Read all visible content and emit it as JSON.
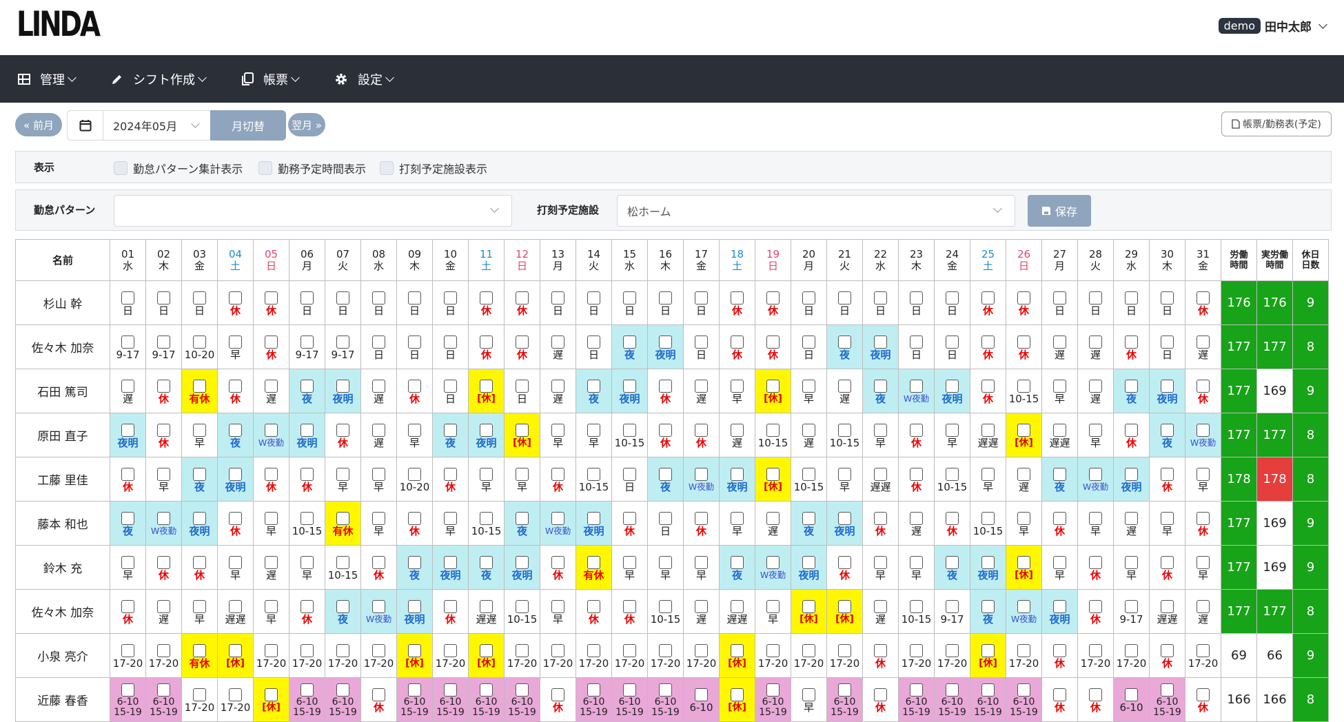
{
  "app": {
    "logo": "LINDA"
  },
  "user": {
    "badge": "demo",
    "name": "田中太郎"
  },
  "nav": [
    {
      "label": "管理",
      "icon": "grid-icon"
    },
    {
      "label": "シフト作成",
      "icon": "pencil-icon"
    },
    {
      "label": "帳票",
      "icon": "copy-icon"
    },
    {
      "label": "設定",
      "icon": "gear-icon"
    }
  ],
  "toolbar": {
    "prev": "« 前月",
    "month": "2024年05月",
    "switch": "月切替",
    "next": "翌月 »",
    "report": "帳票/勤務表(予定)"
  },
  "display": {
    "label": "表示",
    "options": [
      "勤怠パターン集計表示",
      "勤務予定時間表示",
      "打刻予定施設表示"
    ]
  },
  "filter": {
    "pattern_label": "勤怠パターン",
    "pattern_value": "",
    "facility_label": "打刻予定施設",
    "facility_value": "松ホーム",
    "save": "保存"
  },
  "table": {
    "header_name": "名前",
    "days": [
      {
        "d": "01",
        "w": "水"
      },
      {
        "d": "02",
        "w": "木"
      },
      {
        "d": "03",
        "w": "金"
      },
      {
        "d": "04",
        "w": "土"
      },
      {
        "d": "05",
        "w": "日"
      },
      {
        "d": "06",
        "w": "月"
      },
      {
        "d": "07",
        "w": "火"
      },
      {
        "d": "08",
        "w": "水"
      },
      {
        "d": "09",
        "w": "木"
      },
      {
        "d": "10",
        "w": "金"
      },
      {
        "d": "11",
        "w": "土"
      },
      {
        "d": "12",
        "w": "日"
      },
      {
        "d": "13",
        "w": "月"
      },
      {
        "d": "14",
        "w": "火"
      },
      {
        "d": "15",
        "w": "水"
      },
      {
        "d": "16",
        "w": "木"
      },
      {
        "d": "17",
        "w": "金"
      },
      {
        "d": "18",
        "w": "土"
      },
      {
        "d": "19",
        "w": "日"
      },
      {
        "d": "20",
        "w": "月"
      },
      {
        "d": "21",
        "w": "火"
      },
      {
        "d": "22",
        "w": "水"
      },
      {
        "d": "23",
        "w": "木"
      },
      {
        "d": "24",
        "w": "金"
      },
      {
        "d": "25",
        "w": "土"
      },
      {
        "d": "26",
        "w": "日"
      },
      {
        "d": "27",
        "w": "月"
      },
      {
        "d": "28",
        "w": "火"
      },
      {
        "d": "29",
        "w": "水"
      },
      {
        "d": "30",
        "w": "木"
      },
      {
        "d": "31",
        "w": "金"
      }
    ],
    "sum_headers": [
      [
        "労働",
        "時間"
      ],
      [
        "実労働",
        "時間"
      ],
      [
        "休日",
        "日数"
      ]
    ],
    "rows": [
      {
        "name": "杉山 幹",
        "cells": [
          "日",
          "日",
          "日",
          "休",
          "休",
          "日",
          "日",
          "日",
          "日",
          "日",
          "休",
          "休",
          "日",
          "日",
          "日",
          "日",
          "日",
          "休",
          "休",
          "日",
          "日",
          "日",
          "日",
          "日",
          "休",
          "休",
          "日",
          "日",
          "日",
          "日",
          "休"
        ],
        "h1": "176",
        "h2": "176",
        "off": "9"
      },
      {
        "name": "佐々木 加奈",
        "cells": [
          "9-17",
          "9-17",
          "10-20",
          "早",
          "休",
          "9-17",
          "9-17",
          "日",
          "日",
          "日",
          "休",
          "休",
          "遅",
          "日",
          "夜",
          "夜明",
          "日",
          "休",
          "休",
          "日",
          "夜",
          "夜明",
          "日",
          "日",
          "休",
          "休",
          "遅",
          "遅",
          "休",
          "日",
          "遅"
        ],
        "h1": "177",
        "h2": "177",
        "off": "8"
      },
      {
        "name": "石田 篤司",
        "cells": [
          "遅",
          "休",
          "有休",
          "休",
          "遅",
          "夜",
          "夜明",
          "遅",
          "休",
          "日",
          "[休]",
          "日",
          "遅",
          "夜",
          "夜明",
          "休",
          "遅",
          "早",
          "[休]",
          "早",
          "遅",
          "夜",
          "W夜勤",
          "夜明",
          "休",
          "10-15",
          "早",
          "遅",
          "夜",
          "夜明",
          "休"
        ],
        "h1": "177",
        "h2": "169",
        "off": "9"
      },
      {
        "name": "原田 直子",
        "cells": [
          "夜明",
          "休",
          "早",
          "夜",
          "W夜勤",
          "夜明",
          "休",
          "遅",
          "早",
          "夜",
          "夜明",
          "[休]",
          "早",
          "早",
          "10-15",
          "休",
          "休",
          "遅",
          "10-15",
          "遅",
          "10-15",
          "早",
          "休",
          "早",
          "遅遅",
          "[休]",
          "遅遅",
          "早",
          "休",
          "夜",
          "W夜勤"
        ],
        "h1": "177",
        "h2": "177",
        "off": "8"
      },
      {
        "name": "工藤 里佳",
        "cells": [
          "休",
          "早",
          "夜",
          "夜明",
          "休",
          "休",
          "早",
          "早",
          "10-20",
          "休",
          "早",
          "早",
          "休",
          "10-15",
          "日",
          "夜",
          "W夜勤",
          "夜明",
          "[休]",
          "10-15",
          "早",
          "遅遅",
          "休",
          "10-15",
          "早",
          "遅",
          "夜",
          "W夜勤",
          "夜明",
          "休",
          "早"
        ],
        "h1": "178",
        "h2": "178",
        "off": "8"
      },
      {
        "name": "藤本 和也",
        "cells": [
          "夜",
          "W夜勤",
          "夜明",
          "休",
          "早",
          "10-15",
          "有休",
          "早",
          "休",
          "早",
          "10-15",
          "夜",
          "W夜勤",
          "夜明",
          "休",
          "日",
          "休",
          "早",
          "遅",
          "夜",
          "夜明",
          "休",
          "遅",
          "休",
          "10-15",
          "早",
          "休",
          "早",
          "遅",
          "早",
          "休"
        ],
        "h1": "177",
        "h2": "169",
        "off": "9"
      },
      {
        "name": "鈴木 充",
        "cells": [
          "早",
          "休",
          "休",
          "早",
          "遅",
          "早",
          "10-15",
          "休",
          "夜",
          "夜明",
          "夜",
          "夜明",
          "休",
          "有休",
          "早",
          "早",
          "早",
          "夜",
          "W夜勤",
          "夜明",
          "休",
          "早",
          "早",
          "夜",
          "夜明",
          "[休]",
          "早",
          "休",
          "早",
          "休",
          "早"
        ],
        "h1": "177",
        "h2": "169",
        "off": "9"
      },
      {
        "name": "佐々木 加奈",
        "cells": [
          "休",
          "遅",
          "早",
          "遅遅",
          "早",
          "休",
          "夜",
          "W夜勤",
          "夜明",
          "休",
          "遅遅",
          "10-15",
          "早",
          "休",
          "休",
          "10-15",
          "遅",
          "遅遅",
          "早",
          "[休]",
          "[休]",
          "遅",
          "10-15",
          "9-17",
          "夜",
          "W夜勤",
          "夜明",
          "休",
          "9-17",
          "遅遅",
          "遅"
        ],
        "h1": "177",
        "h2": "177",
        "off": "8"
      },
      {
        "name": "小泉 亮介",
        "cells": [
          "17-20",
          "17-20",
          "有休",
          "[休]",
          "17-20",
          "17-20",
          "17-20",
          "17-20",
          "[休]",
          "17-20",
          "[休]",
          "17-20",
          "17-20",
          "17-20",
          "17-20",
          "17-20",
          "17-20",
          "[休]",
          "17-20",
          "17-20",
          "17-20",
          "休",
          "17-20",
          "17-20",
          "[休]",
          "17-20",
          "休",
          "17-20",
          "17-20",
          "休",
          "17-20"
        ],
        "h1": "69",
        "h2": "66",
        "off": "9"
      },
      {
        "name": "近藤 春香",
        "cells": [
          "6-10 15-19",
          "6-10 15-19",
          "17-20",
          "17-20",
          "[休]",
          "6-10 15-19",
          "6-10 15-19",
          "休",
          "6-10 15-19",
          "6-10 15-19",
          "6-10 15-19",
          "6-10 15-19",
          "休",
          "6-10 15-19",
          "6-10 15-19",
          "6-10 15-19",
          "6-10",
          "[休]",
          "6-10 15-19",
          "早",
          "6-10 15-19",
          "休",
          "6-10 15-19",
          "6-10 15-19",
          "6-10 15-19",
          "6-10 15-19",
          "休",
          "休",
          "6-10",
          "6-10 15-19",
          "休"
        ],
        "h1": "166",
        "h2": "166",
        "off": "8"
      }
    ]
  }
}
